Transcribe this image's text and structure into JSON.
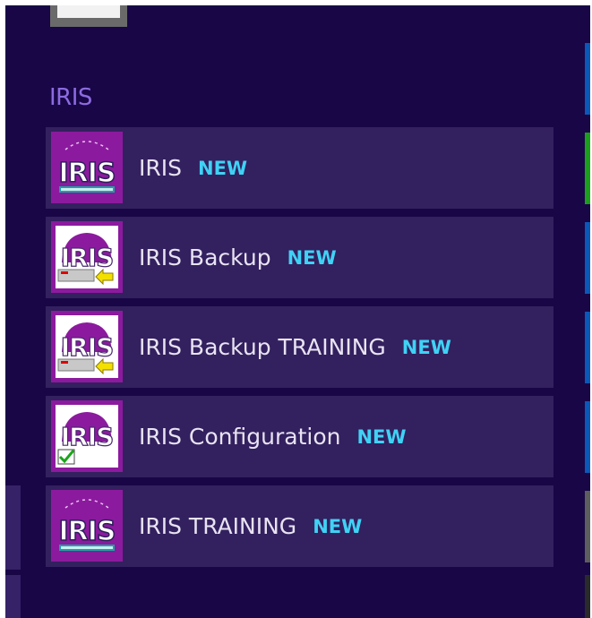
{
  "group": {
    "title": "IRIS"
  },
  "apps": [
    {
      "label": "IRIS",
      "badge": "NEW",
      "icon": "iris-logo-icon"
    },
    {
      "label": "IRIS Backup",
      "badge": "NEW",
      "icon": "iris-backup-icon"
    },
    {
      "label": "IRIS Backup TRAINING",
      "badge": "NEW",
      "icon": "iris-backup-icon"
    },
    {
      "label": "IRIS Configuration",
      "badge": "NEW",
      "icon": "iris-configuration-icon"
    },
    {
      "label": "IRIS TRAINING",
      "badge": "NEW",
      "icon": "iris-logo-icon"
    }
  ],
  "colors": {
    "background": "#180647",
    "tile": "#33205f",
    "icon_bg": "#8c1a9e",
    "group_title": "#8c6be0",
    "badge": "#3fd2f5",
    "label": "#e8e3f2"
  }
}
